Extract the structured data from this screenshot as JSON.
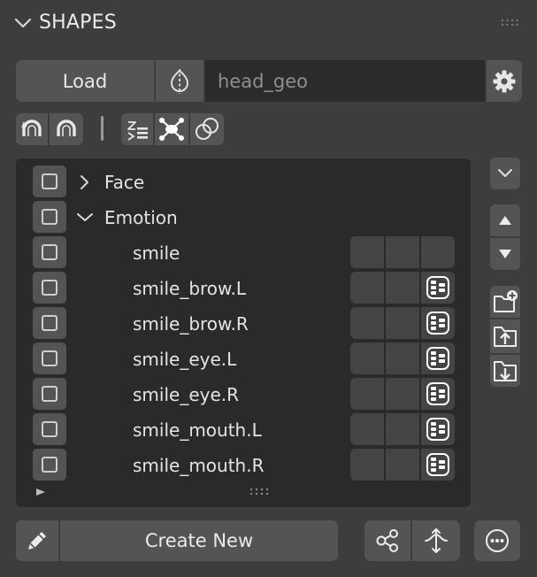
{
  "panel": {
    "title": "SHAPES",
    "header_icon": "chevron-down-icon",
    "grip_icon": "drag-grip-icon"
  },
  "load_row": {
    "load_label": "Load",
    "mirror_icon": "mirror-icon",
    "mesh_value": "head_geo",
    "settings_icon": "gear-icon"
  },
  "toolbar": {
    "icons": [
      "magnet-left-icon",
      "magnet-right-icon",
      "sort-icon",
      "node-icon",
      "overlap-circles-icon"
    ]
  },
  "list": {
    "groups": [
      {
        "label": "Face",
        "expanded": false
      },
      {
        "label": "Emotion",
        "expanded": true
      }
    ],
    "items": [
      {
        "label": "smile",
        "has_driver": false
      },
      {
        "label": "smile_brow.L",
        "has_driver": true
      },
      {
        "label": "smile_brow.R",
        "has_driver": true
      },
      {
        "label": "smile_eye.L",
        "has_driver": true
      },
      {
        "label": "smile_eye.R",
        "has_driver": true
      },
      {
        "label": "smile_mouth.L",
        "has_driver": true
      },
      {
        "label": "smile_mouth.R",
        "has_driver": true
      }
    ]
  },
  "side": {
    "icons": [
      "chevron-down-icon",
      "arrow-up-icon",
      "arrow-down-icon",
      "add-folder-icon",
      "folder-up-icon",
      "folder-down-icon"
    ]
  },
  "bottom": {
    "create_label": "Create New",
    "icons": [
      "pencil-icon",
      "share-icon",
      "flip-icon",
      "more-icon"
    ]
  },
  "colors": {
    "background": "#3d3d3d",
    "button": "#545454",
    "field": "#2b2b2b",
    "list": "#2a2a2a"
  }
}
